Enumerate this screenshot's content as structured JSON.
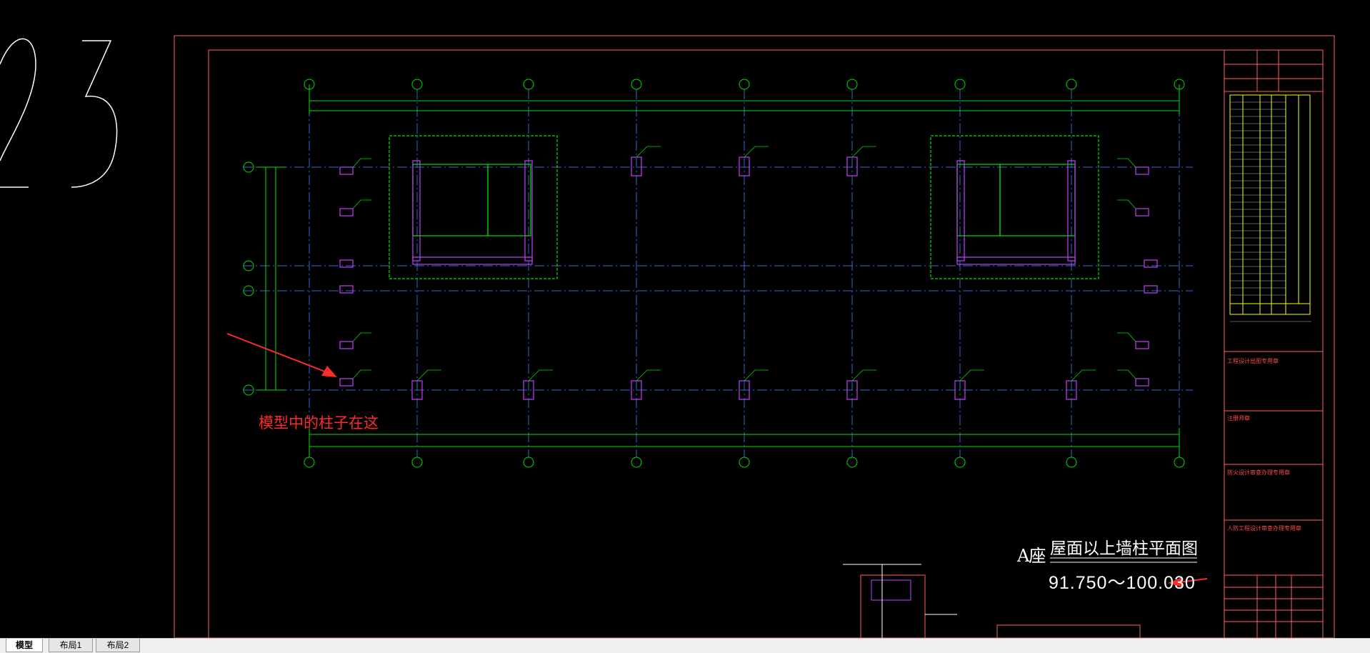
{
  "drawing": {
    "annotation": "模型中的柱子在这",
    "title_prefix": "A座",
    "title": "屋面以上墙柱平面图",
    "elevation_range": "91.750～100.030",
    "large_number": "23"
  },
  "title_block": {
    "section_1": "工程设计出图专用章",
    "section_2": "注册师章",
    "section_3": "防火设计审查办理专用章",
    "section_4": "人防工程设计审查办理专用章"
  },
  "tabs": [
    {
      "label": "模型",
      "active": true
    },
    {
      "label": "布局1",
      "active": false
    },
    {
      "label": "布局2",
      "active": false
    }
  ],
  "colors": {
    "background": "#000000",
    "frame": "#ff6060",
    "grid_line": "#00e000",
    "axis_line": "#2a6ad8",
    "column": "#c040ff",
    "annotation": "#ff2a2a",
    "title_block_highlight": "#ffff00"
  }
}
